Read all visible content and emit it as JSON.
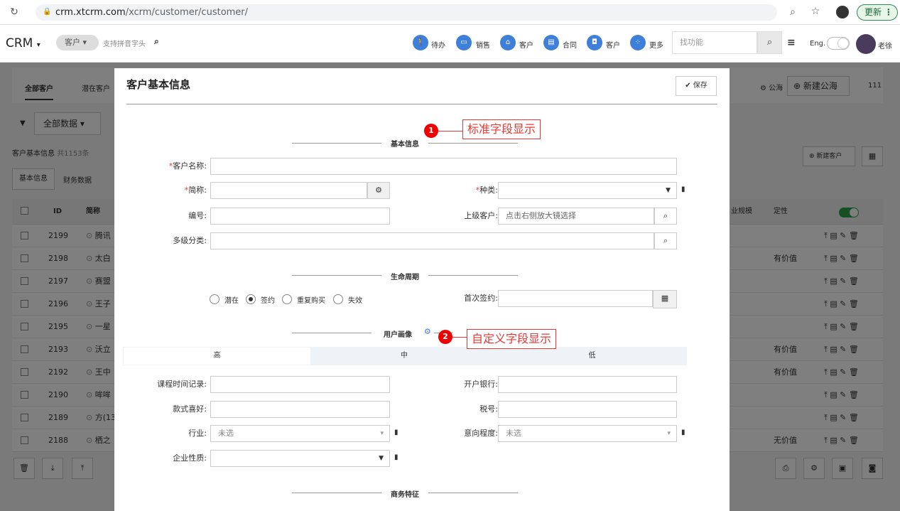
{
  "browser": {
    "url_domain": "crm.xtcrm.com",
    "url_path": "/xcrm/customer/customer/",
    "update_label": "更新"
  },
  "nav": {
    "logo": "CRM",
    "search_scope": "客户",
    "search_placeholder": "支持拼音字头",
    "items": [
      {
        "label": "待办",
        "icon": "person-icon"
      },
      {
        "label": "销售",
        "icon": "card-icon"
      },
      {
        "label": "客户",
        "icon": "bank-icon"
      },
      {
        "label": "合同",
        "icon": "document-icon"
      },
      {
        "label": "客户",
        "icon": "briefcase-icon"
      },
      {
        "label": "更多",
        "icon": "grid-icon"
      }
    ],
    "func_placeholder": "找功能",
    "lang": "Eng.",
    "user": "老徐"
  },
  "page": {
    "tabs": [
      "全部客户",
      "潜在客户"
    ],
    "filter_label": "全部数据",
    "count_prefix": "客户基本信息",
    "count_text": "共1153条",
    "subtabs": [
      "基本信息",
      "财务数据"
    ],
    "right_links": [
      "公海",
      "新建公海",
      "111"
    ],
    "new_customer": "新建客户",
    "columns": [
      "ID",
      "简称",
      "业规模",
      "定性"
    ],
    "rows": [
      {
        "id": "2199",
        "name": "腾讯",
        "value": ""
      },
      {
        "id": "2198",
        "name": "太白",
        "value": "有价值"
      },
      {
        "id": "2197",
        "name": "赛盟",
        "value": ""
      },
      {
        "id": "2196",
        "name": "王子",
        "value": ""
      },
      {
        "id": "2195",
        "name": "一星",
        "value": ""
      },
      {
        "id": "2193",
        "name": "沃立",
        "value": "有价值"
      },
      {
        "id": "2192",
        "name": "王中",
        "value": "有价值"
      },
      {
        "id": "2190",
        "name": "哞哞",
        "value": ""
      },
      {
        "id": "2189",
        "name": "方(13",
        "value": ""
      },
      {
        "id": "2188",
        "name": "栖之",
        "value": "无价值"
      }
    ]
  },
  "modal": {
    "title": "客户基本信息",
    "save": "保存",
    "sections": {
      "basic": "基本信息",
      "lifecycle": "生命周期",
      "persona": "用户画像",
      "business": "商务特征"
    },
    "fields": {
      "customer_name": "客户名称:",
      "short_name": "简称:",
      "category": "种类:",
      "code": "编号:",
      "parent": "上级客户:",
      "parent_placeholder": "点击右侧放大镜选择",
      "multi_category": "多级分类:",
      "first_sign": "首次签约:",
      "course_time": "课程时间记录:",
      "bank": "开户银行:",
      "style_pref": "款式喜好:",
      "tax_no": "税号:",
      "industry": "行业:",
      "industry_value": "未选",
      "intent": "意向程度:",
      "intent_value": "未选",
      "enterprise": "企业性质:"
    },
    "lifecycle_options": [
      "潜在",
      "签约",
      "重复购买",
      "失效"
    ],
    "persona_tabs": [
      "高",
      "中",
      "低"
    ]
  },
  "annotations": [
    {
      "num": "1",
      "text": "标准字段显示"
    },
    {
      "num": "2",
      "text": "自定义字段显示"
    }
  ]
}
